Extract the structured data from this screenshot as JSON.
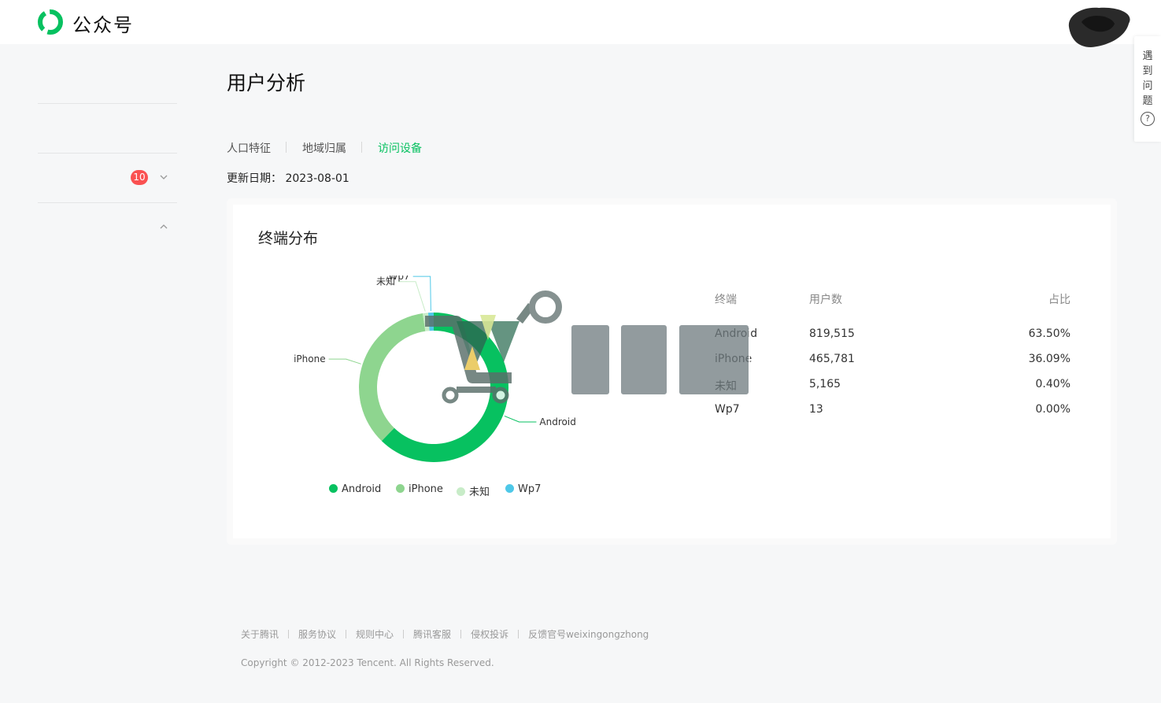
{
  "header": {
    "brand": "公众号",
    "help_label": "遇到问题",
    "help_icon_glyph": "?"
  },
  "sidebar": {
    "badge_count": "10"
  },
  "page": {
    "title": "用户分析",
    "tabs": [
      {
        "label": "人口特征",
        "active": false
      },
      {
        "label": "地域归属",
        "active": false
      },
      {
        "label": "访问设备",
        "active": true
      }
    ],
    "update_label": "更新日期：",
    "update_date": "2023-08-01"
  },
  "card": {
    "title": "终端分布",
    "table": {
      "headers": [
        "终端",
        "用户数",
        "占比"
      ],
      "rows": [
        [
          "Android",
          "819,515",
          "63.50%"
        ],
        [
          "iPhone",
          "465,781",
          "36.09%"
        ],
        [
          "未知",
          "5,165",
          "0.40%"
        ],
        [
          "Wp7",
          "13",
          "0.00%"
        ]
      ]
    }
  },
  "chart_data": {
    "type": "pie",
    "categories": [
      "Android",
      "iPhone",
      "未知",
      "Wp7"
    ],
    "values": [
      819515,
      465781,
      5165,
      13
    ],
    "percent": [
      63.5,
      36.09,
      0.4,
      0.0
    ],
    "colors": [
      "#07c160",
      "#8ed58f",
      "#c8ecc8",
      "#4ec8e8"
    ],
    "donut": true,
    "legend_position": "bottom"
  },
  "footer": {
    "links": [
      "关于腾讯",
      "服务协议",
      "规则中心",
      "腾讯客服",
      "侵权投诉",
      "反馈官号weixingongzhong"
    ],
    "copyright": "Copyright © 2012-2023 Tencent. All Rights Reserved."
  },
  "theme": {
    "accent": "#07c160",
    "badge": "#fa5151"
  }
}
